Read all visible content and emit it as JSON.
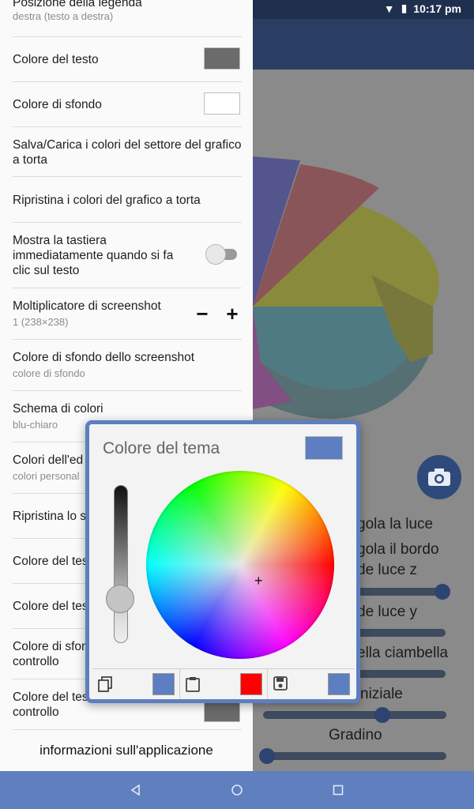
{
  "status_bar": {
    "time": "10:17 pm",
    "wifi_icon": "wifi-icon",
    "battery_icon": "battery-icon"
  },
  "settings": [
    {
      "title": "Posizione della legenda",
      "subtitle": "destra (testo a destra)"
    },
    {
      "title": "Colore del testo",
      "swatch_color": "#6b6b6b"
    },
    {
      "title": "Colore di sfondo",
      "swatch_color": "#ffffff"
    },
    {
      "title": "Salva/Carica i colori del settore del grafico a torta"
    },
    {
      "title": "Ripristina i colori del grafico a torta"
    },
    {
      "title": "Mostra la tastiera immediatamente quando si fa clic sul testo",
      "toggle_on": false
    },
    {
      "title": "Moltiplicatore di screenshot",
      "subtitle": "1 (238×238)",
      "minus": "−",
      "plus": "+"
    },
    {
      "title": "Colore di sfondo dello screenshot",
      "subtitle": "colore di sfondo"
    },
    {
      "title": "Schema di colori",
      "subtitle": "blu-chiaro"
    },
    {
      "title": "Colori dell'ed",
      "subtitle": "colori personal"
    },
    {
      "title": "Ripristina lo s"
    },
    {
      "title": "Colore del tes"
    },
    {
      "title": "Colore del tes"
    },
    {
      "title": "Colore di sfon",
      "title2": "controllo"
    },
    {
      "title": "Colore del tes",
      "title2": "controllo",
      "swatch_color": "#6b6b6b"
    }
  ],
  "app_info": "informazioni sull'applicazione",
  "background_controls": {
    "labels": [
      "gola la luce",
      "gola il bordo",
      "de luce z",
      "de luce y",
      "ella ciambella",
      "niziale",
      "Gradino"
    ],
    "sliders": [
      0.98,
      0.98,
      0.98,
      0.65,
      0.02
    ]
  },
  "dialog": {
    "title": "Colore del tema",
    "preview_color": "#5d7ec0",
    "brightness_level": 0.72,
    "footer": [
      {
        "icon": "copy-icon",
        "swatch_color": "#5d7ec0"
      },
      {
        "icon": "paste-icon",
        "swatch_color": "#ff0000"
      },
      {
        "icon": "save-icon",
        "swatch_color": "#5d7ec0"
      }
    ]
  },
  "nav": {
    "back": "back-icon",
    "home": "home-icon",
    "recents": "recents-icon"
  }
}
